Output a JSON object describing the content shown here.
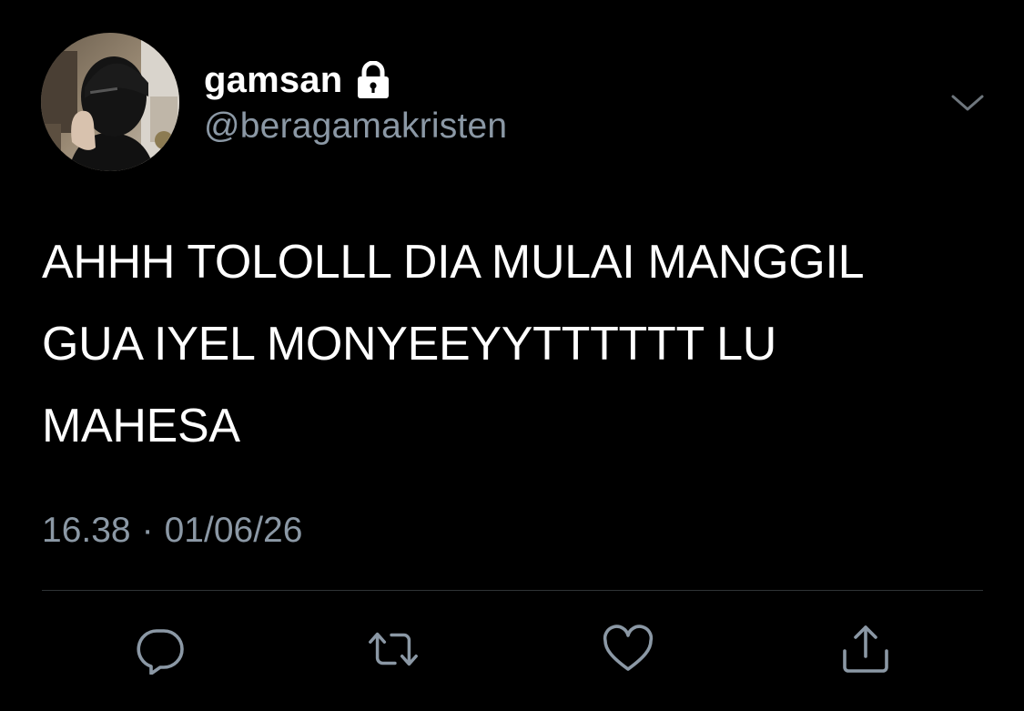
{
  "user": {
    "display_name": "gamsan",
    "handle": "@beragamakristen",
    "protected_icon": "lock-icon",
    "avatar_icon": "profile-photo"
  },
  "tweet": {
    "text_lines": [
      "AHHH TOLOLLL DIA MULAI MANGGIL",
      "GUA IYEL MONYEEYYTTTTTT LU",
      "MAHESA"
    ],
    "time": "16.38",
    "separator": "·",
    "date": "01/06/26"
  },
  "actions": [
    {
      "name": "reply",
      "icon": "reply-icon"
    },
    {
      "name": "retweet",
      "icon": "retweet-icon"
    },
    {
      "name": "like",
      "icon": "heart-icon"
    },
    {
      "name": "share",
      "icon": "share-icon"
    }
  ],
  "colors": {
    "background": "#000000",
    "primary_text": "#ffffff",
    "secondary_text": "#8b98a5",
    "divider": "#2f3336"
  }
}
